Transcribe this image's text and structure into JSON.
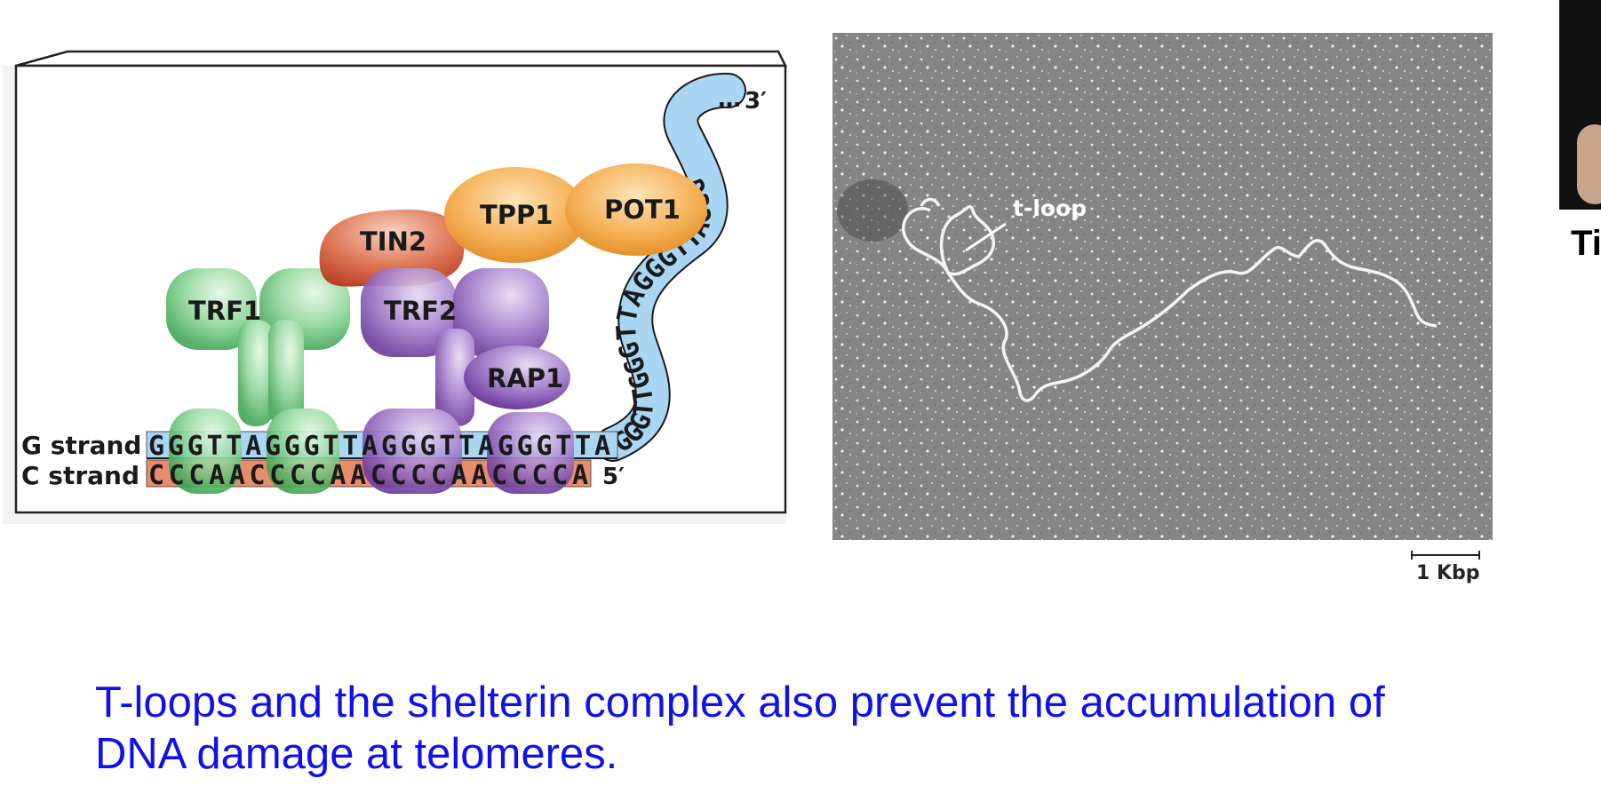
{
  "diagram": {
    "proteins": {
      "trf1": "TRF1",
      "trf2": "TRF2",
      "tin2": "TIN2",
      "tpp1": "TPP1",
      "pot1": "POT1",
      "rap1": "RAP1"
    },
    "strands": {
      "g_label": "G strand",
      "c_label": "C strand",
      "g_sequence": "GGGTTAGGGTTAGGGTTAGGGTTA",
      "c_sequence": "CCCAACCCCAACCCCAACCCCA",
      "overhang_sequence": "GGGTTGGGTTAGGGTTAGGG",
      "three_prime": "3′",
      "five_prime": "5′",
      "ellipsis": "…"
    },
    "colors": {
      "g_strand": "#a9d6f3",
      "c_strand": "#e98c6e",
      "trf1": "#5cbf6c",
      "trf2": "#8f63b8",
      "tin2": "#d86547",
      "tpp1_pot1": "#f2a23e",
      "rap1": "#9a6cc0"
    }
  },
  "micrograph": {
    "tloop_label": "t-loop",
    "scale_label": "1 Kbp"
  },
  "photo": {
    "name_fragment": "Ti"
  },
  "caption": {
    "line1": "T-loops and the shelterin complex also prevent the accumulation of",
    "line2": "DNA damage at telomeres."
  }
}
